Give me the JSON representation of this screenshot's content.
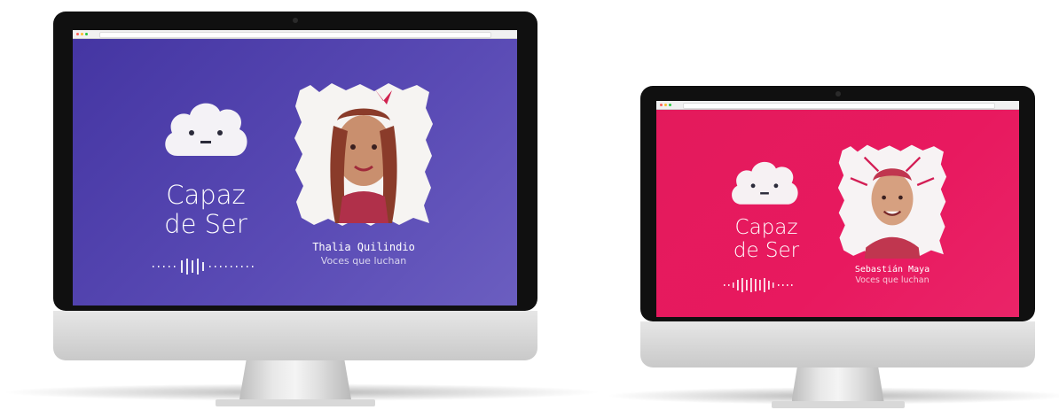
{
  "colors": {
    "screen_left": "#4b3aa8",
    "screen_right": "#e3175f",
    "frame": "#101010",
    "chin": "#d5d5d5"
  },
  "left_screen": {
    "title_line1": "Capaz",
    "title_line2": "de Ser",
    "guest_name": "Thalia Quilindio",
    "episode_title": "Voces que luchan",
    "logo_icon": "cloud-face-icon",
    "waveform_icon": "audio-waveform-icon"
  },
  "right_screen": {
    "title_line1": "Capaz",
    "title_line2": "de Ser",
    "guest_name": "Sebastián Maya",
    "episode_title": "Voces que luchan",
    "logo_icon": "cloud-face-icon",
    "waveform_icon": "audio-waveform-icon"
  }
}
